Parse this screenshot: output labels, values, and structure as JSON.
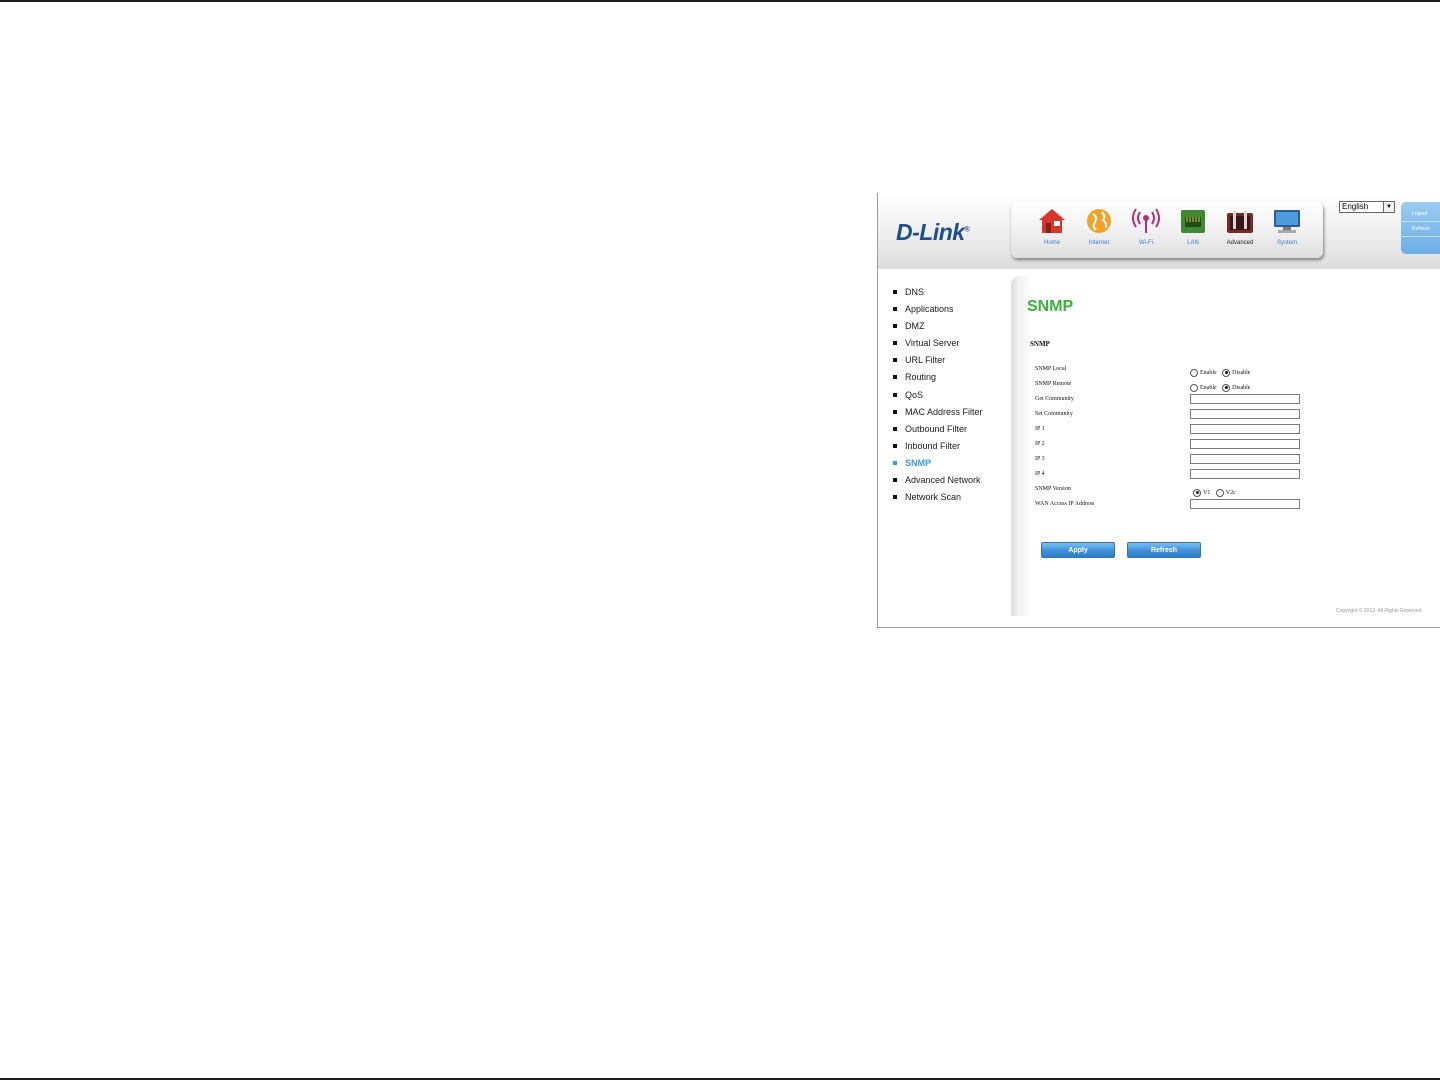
{
  "brand": {
    "logo": "D-Link",
    "mark": "®"
  },
  "nav": [
    {
      "label": "Home",
      "icon": "home-icon"
    },
    {
      "label": "Internet",
      "icon": "globe-icon"
    },
    {
      "label": "Wi-Fi",
      "icon": "wifi-icon"
    },
    {
      "label": "LAN",
      "icon": "lan-icon"
    },
    {
      "label": "Advanced",
      "icon": "toolbox-icon"
    },
    {
      "label": "System",
      "icon": "monitor-icon"
    }
  ],
  "language": {
    "selected": "English"
  },
  "account": {
    "logout": "Logout",
    "refresh": "Refresh"
  },
  "sidebar": {
    "items": [
      "DNS",
      "Applications",
      "DMZ",
      "Virtual Server",
      "URL Filter",
      "Routing",
      "QoS",
      "MAC Address Filter",
      "Outbound Filter",
      "Inbound Filter",
      "SNMP",
      "Advanced Network",
      "Network Scan"
    ],
    "active": "SNMP"
  },
  "page": {
    "title": "SNMP",
    "section": "SNMP"
  },
  "form": {
    "snmp_local": {
      "label": "SNMP Local",
      "options": [
        "Enable",
        "Disable"
      ],
      "selected": "Disable"
    },
    "snmp_remote": {
      "label": "SNMP Remote",
      "options": [
        "Enable",
        "Disable"
      ],
      "selected": "Disable"
    },
    "get_community": {
      "label": "Get Community",
      "value": ""
    },
    "set_community": {
      "label": "Set Community",
      "value": ""
    },
    "ip1": {
      "label": "IP 1",
      "value": ""
    },
    "ip2": {
      "label": "IP 2",
      "value": ""
    },
    "ip3": {
      "label": "IP 3",
      "value": ""
    },
    "ip4": {
      "label": "IP 4",
      "value": ""
    },
    "snmp_version": {
      "label": "SNMP Version",
      "options": [
        "V1",
        "V2c"
      ],
      "selected": "V1"
    },
    "wan_access": {
      "label": "WAN Access IP Address",
      "value": ""
    }
  },
  "buttons": {
    "apply": "Apply",
    "refresh": "Refresh"
  },
  "footer": {
    "copyright": "Copyright © 2012. All Rights Reserved."
  },
  "colors": {
    "title_green": "#3fae3f",
    "active_blue": "#3a9ad9",
    "button_blue": "#3f8fd9",
    "logo_blue": "#1f4e8c"
  }
}
